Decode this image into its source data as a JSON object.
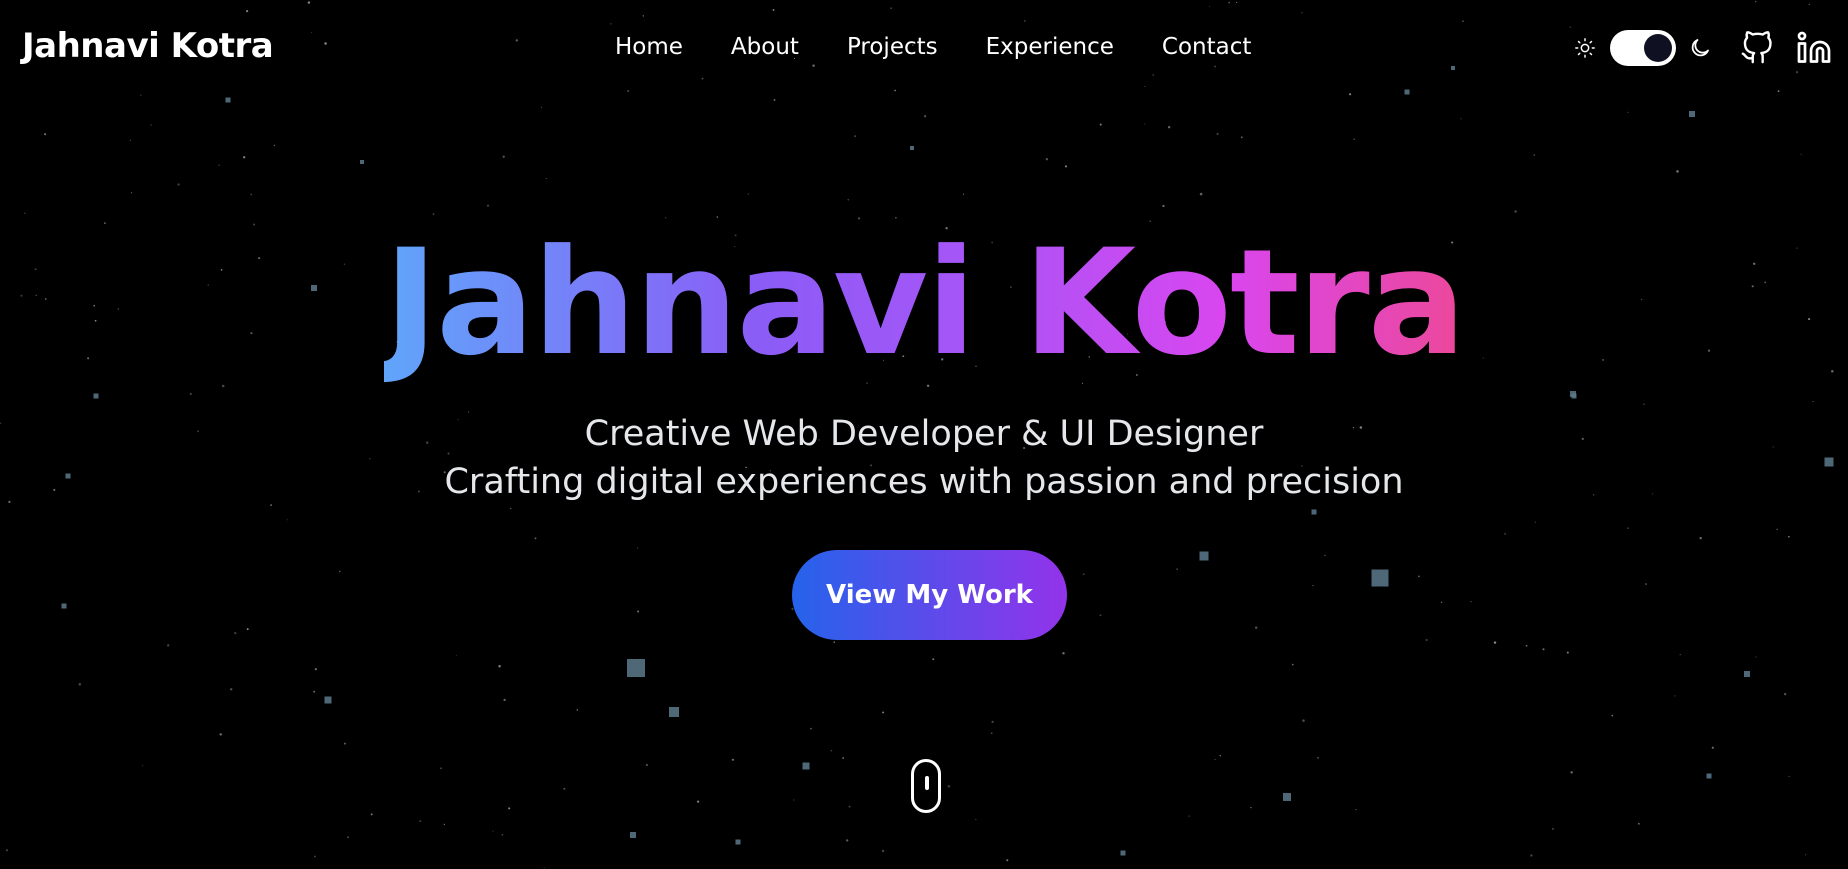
{
  "header": {
    "brand": "Jahnavi Kotra",
    "nav": [
      "Home",
      "About",
      "Projects",
      "Experience",
      "Contact"
    ],
    "theme_toggle": {
      "mode": "dark"
    },
    "icons": [
      "sun-icon",
      "moon-icon",
      "github-icon",
      "linkedin-icon"
    ]
  },
  "hero": {
    "title": "Jahnavi Kotra",
    "subtitle": "Creative Web Developer & UI Designer",
    "tagline": "Crafting digital experiences with passion and precision",
    "cta_label": "View My Work"
  },
  "colors": {
    "background": "#000000",
    "title_gradient": [
      "#60a5fa",
      "#8b5cf6",
      "#d946ef",
      "#ec4899"
    ],
    "cta_gradient": [
      "#2563eb",
      "#9333ea"
    ],
    "particle": "#5c7a8c"
  }
}
